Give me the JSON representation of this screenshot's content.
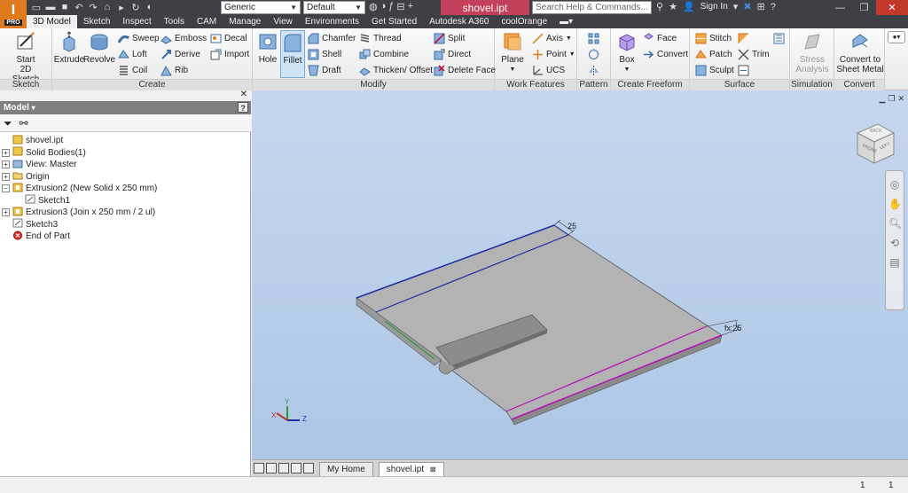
{
  "app": {
    "logo": "I",
    "edition": "PRO"
  },
  "titlebar": {
    "material": "Generic",
    "appearance": "Default",
    "document_title": "shovel.ipt",
    "search_placeholder": "Search Help & Commands...",
    "sign_in": "Sign In"
  },
  "tabs": [
    "3D Model",
    "Sketch",
    "Inspect",
    "Tools",
    "CAM",
    "Manage",
    "View",
    "Environments",
    "Get Started",
    "Autodesk A360",
    "coolOrange"
  ],
  "ribbon": {
    "sketch": {
      "title": "Sketch",
      "start_line1": "Start",
      "start_line2": "2D Sketch"
    },
    "create": {
      "title": "Create",
      "extrude": "Extrude",
      "revolve": "Revolve",
      "sweep": "Sweep",
      "loft": "Loft",
      "coil": "Coil",
      "emboss": "Emboss",
      "derive": "Derive",
      "rib": "Rib",
      "decal": "Decal",
      "import": "Import"
    },
    "modify": {
      "title": "Modify",
      "hole": "Hole",
      "fillet": "Fillet",
      "chamfer": "Chamfer",
      "shell": "Shell",
      "draft": "Draft",
      "thread": "Thread",
      "combine": "Combine",
      "thicken": "Thicken/ Offset",
      "split": "Split",
      "direct": "Direct",
      "delete_face": "Delete Face"
    },
    "work_features": {
      "title": "Work Features",
      "plane": "Plane",
      "axis": "Axis",
      "point": "Point",
      "ucs": "UCS"
    },
    "pattern": {
      "title": "Pattern"
    },
    "freeform": {
      "title": "Create Freeform",
      "box": "Box",
      "face": "Face",
      "convert": "Convert"
    },
    "surface": {
      "title": "Surface",
      "stitch": "Stitch",
      "patch": "Patch",
      "sculpt": "Sculpt",
      "trim": "Trim"
    },
    "simulation": {
      "title": "Simulation",
      "stress_line1": "Stress",
      "stress_line2": "Analysis"
    },
    "convert": {
      "title": "Convert",
      "line1": "Convert to",
      "line2": "Sheet Metal"
    }
  },
  "browser": {
    "title": "Model",
    "tree": [
      {
        "label": "shovel.ipt",
        "level": 0,
        "exp": ""
      },
      {
        "label": "Solid Bodies(1)",
        "level": 0,
        "exp": "+"
      },
      {
        "label": "View: Master",
        "level": 0,
        "exp": "+"
      },
      {
        "label": "Origin",
        "level": 0,
        "exp": "+"
      },
      {
        "label": "Extrusion2 (New Solid x 250 mm)",
        "level": 0,
        "exp": "-"
      },
      {
        "label": "Sketch1",
        "level": 1,
        "exp": ""
      },
      {
        "label": "Extrusion3 (Join x 250 mm / 2 ul)",
        "level": 0,
        "exp": "+"
      },
      {
        "label": "Sketch3",
        "level": 0,
        "exp": ""
      },
      {
        "label": "End of Part",
        "level": 0,
        "exp": ""
      }
    ]
  },
  "viewport": {
    "dim1": "25",
    "dim2": "fx:25",
    "viewcube": {
      "front": "FRONT",
      "back": "BACK",
      "left": "LEFT"
    },
    "axes": {
      "x": "X",
      "y": "Y",
      "z": "Z"
    }
  },
  "doctabs": {
    "home": "My Home",
    "file": "shovel.ipt"
  },
  "status": {
    "n1": "1",
    "n2": "1"
  },
  "colors": {
    "title_bg": "#3f3f46",
    "doc_title_bg": "#c33f5a",
    "viewport_top": "#c5d7ee",
    "accent_orange": "#e07a1f"
  }
}
